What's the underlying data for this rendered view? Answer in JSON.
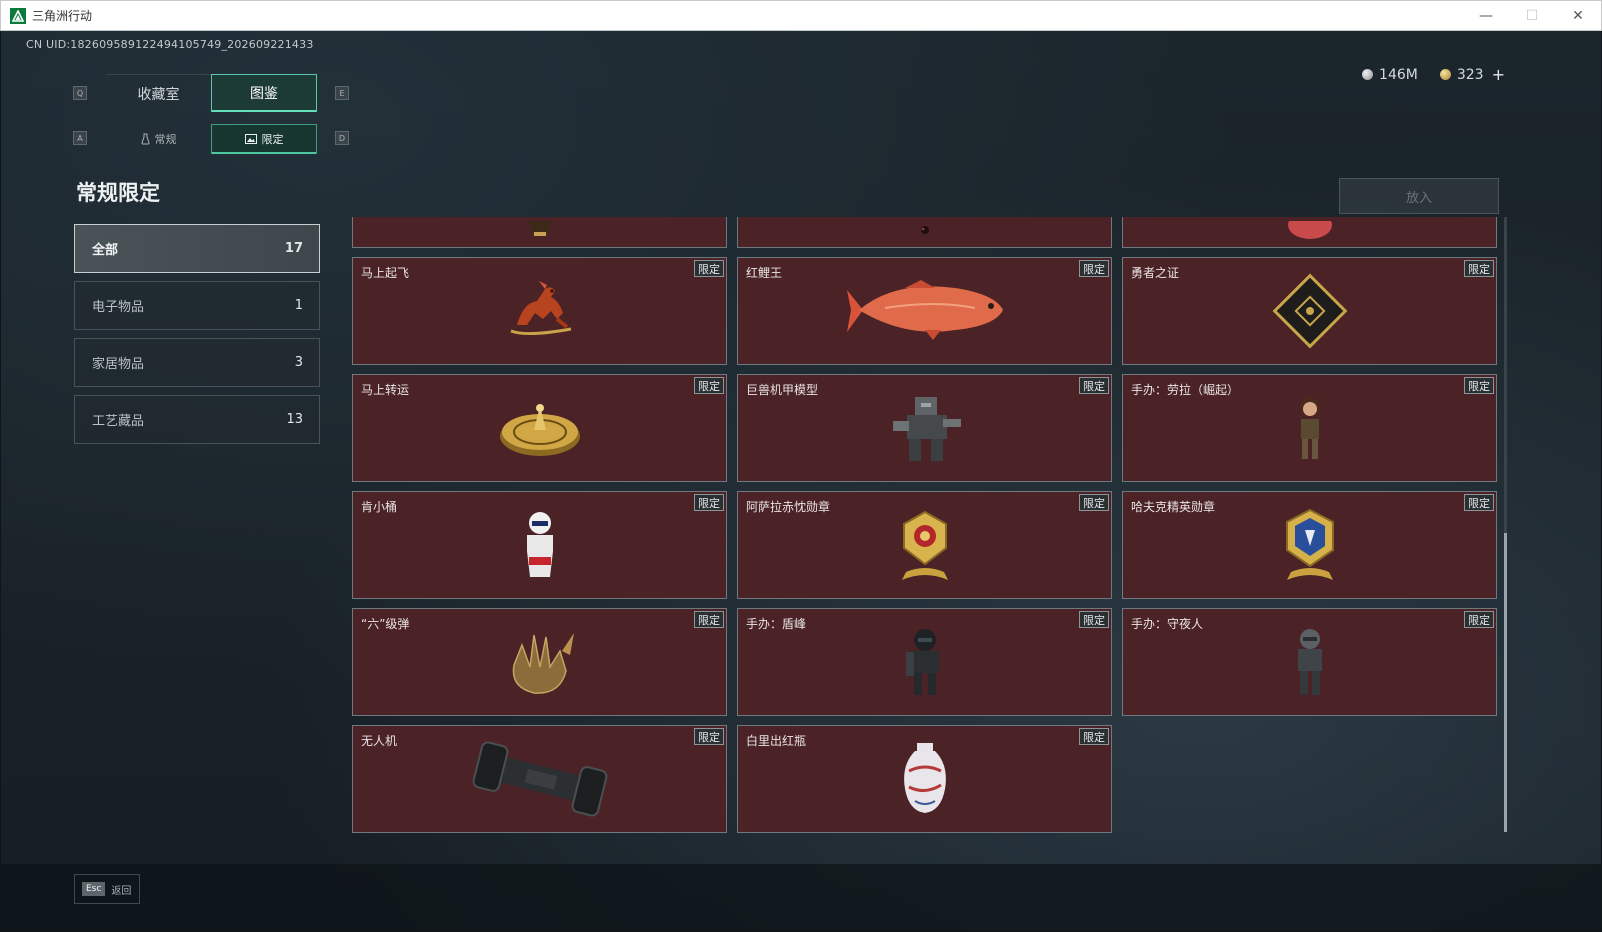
{
  "window": {
    "title": "三角洲行动",
    "minimize": "—",
    "maximize": "☐",
    "close": "✕"
  },
  "uid": "CN UID:18260958912249410574​9_202609221433",
  "currency": {
    "silver": "146M",
    "gold": "323",
    "plus": "+"
  },
  "tabs": {
    "key_left": "Q",
    "key_right": "E",
    "items": [
      {
        "label": "收藏室"
      },
      {
        "label": "图鉴"
      }
    ],
    "active_index": 1
  },
  "subtabs": {
    "key_left": "A",
    "key_right": "D",
    "items": [
      {
        "label": "常规"
      },
      {
        "label": "限定"
      }
    ],
    "active_index": 1
  },
  "page_title": "常规限定",
  "categories": [
    {
      "label": "全部",
      "count": "17"
    },
    {
      "label": "电子物品",
      "count": "1"
    },
    {
      "label": "家居物品",
      "count": "3"
    },
    {
      "label": "工艺藏品",
      "count": "13"
    }
  ],
  "put_button": "放入",
  "cards": [
    {
      "name": "",
      "badge": "",
      "icon": "partial-item-icon"
    },
    {
      "name": "",
      "badge": "",
      "icon": "partial-item-icon"
    },
    {
      "name": "",
      "badge": "",
      "icon": "partial-item-icon"
    },
    {
      "name": "马上起飞",
      "badge": "限定",
      "icon": "horse-statue-icon"
    },
    {
      "name": "红鲤王",
      "badge": "限定",
      "icon": "red-carp-icon"
    },
    {
      "name": "勇者之证",
      "badge": "限定",
      "icon": "card-emblem-icon"
    },
    {
      "name": "马上转运",
      "badge": "限定",
      "icon": "golden-disc-icon"
    },
    {
      "name": "巨兽机甲模型",
      "badge": "限定",
      "icon": "mech-model-icon"
    },
    {
      "name": "手办：劳拉（崛起）",
      "badge": "限定",
      "icon": "figure-icon"
    },
    {
      "name": "肯小桶",
      "badge": "限定",
      "icon": "bucket-figure-icon"
    },
    {
      "name": "阿萨拉赤忱勋章",
      "badge": "限定",
      "icon": "gold-medal-icon"
    },
    {
      "name": "哈夫克精英勋章",
      "badge": "限定",
      "icon": "blue-medal-icon"
    },
    {
      "name": "“六”级弹",
      "badge": "限定",
      "icon": "bullet-hand-icon"
    },
    {
      "name": "手办：盾峰",
      "badge": "限定",
      "icon": "armored-figure-icon"
    },
    {
      "name": "手办：守夜人",
      "badge": "限定",
      "icon": "night-figure-icon"
    },
    {
      "name": "无人机",
      "badge": "限定",
      "icon": "drone-icon"
    },
    {
      "name": "白里出红瓶",
      "badge": "限定",
      "icon": "vase-icon"
    }
  ],
  "footer": {
    "key": "Esc",
    "label": "返回"
  },
  "colors": {
    "accent": "#5dc5a8",
    "card_bg": "#4b2226"
  }
}
